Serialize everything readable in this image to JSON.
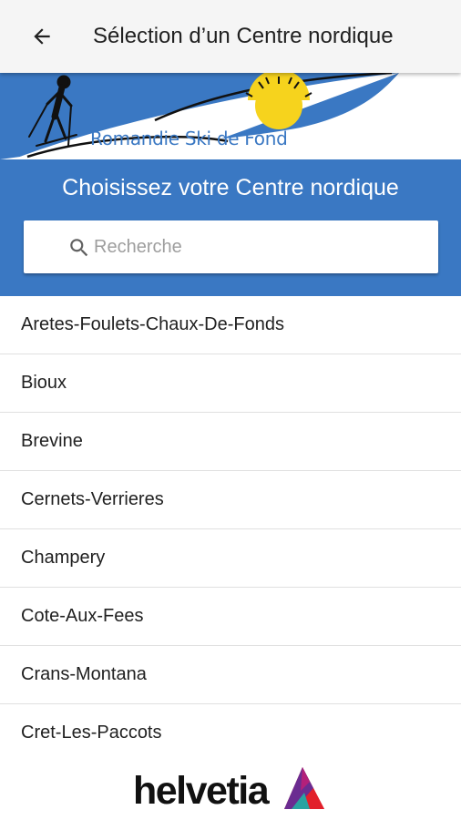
{
  "appbar": {
    "title": "Sélection d’un Centre nordique",
    "back_icon": "arrow-back-icon"
  },
  "banner": {
    "logo_text": "Romandie Ski de Fond",
    "heading": "Choisissez votre Centre nordique",
    "background_color": "#3a78c3"
  },
  "search": {
    "placeholder": "Recherche",
    "value": "",
    "icon": "search-icon"
  },
  "centres": [
    {
      "label": "Aretes-Foulets-Chaux-De-Fonds"
    },
    {
      "label": "Bioux"
    },
    {
      "label": "Brevine"
    },
    {
      "label": "Cernets-Verrieres"
    },
    {
      "label": "Champery"
    },
    {
      "label": "Cote-Aux-Fees"
    },
    {
      "label": "Crans-Montana"
    },
    {
      "label": "Cret-Les-Paccots"
    }
  ],
  "footer": {
    "sponsor_logo_text": "helvetia"
  }
}
